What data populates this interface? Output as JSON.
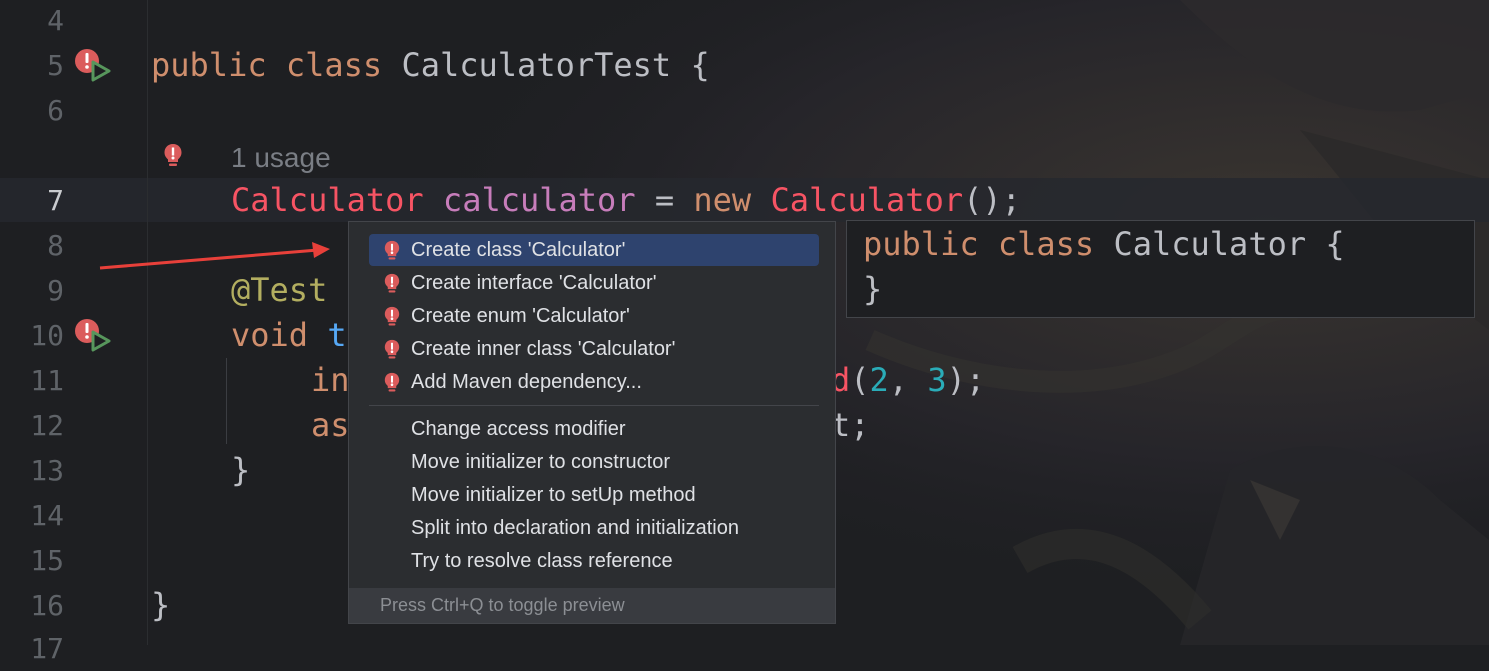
{
  "editor": {
    "line_numbers": [
      "4",
      "5",
      "6",
      "7",
      "8",
      "9",
      "10",
      "11",
      "12",
      "13",
      "14",
      "15",
      "16",
      "17"
    ],
    "current_line": "7",
    "inlay_hint": "1 usage",
    "lines": {
      "l5": {
        "kw1": "public",
        "kw2": "class",
        "name": "CalculatorTest",
        "brace": "{"
      },
      "l7": {
        "type": "Calculator",
        "field": "calculator",
        "eq": "=",
        "kw": "new",
        "ctor": "Calculator",
        "tail": "();"
      },
      "l9": {
        "annotation": "@Test"
      },
      "l10": {
        "kw": "void",
        "rest": "t"
      },
      "l11": {
        "start": "in",
        "call_end": "d",
        "paren": "(",
        "arg1": "2",
        "comma": ", ",
        "arg2": "3",
        "close": ");"
      },
      "l12": {
        "start": "as",
        "end": "t;"
      },
      "l13": {
        "brace": "}"
      },
      "l16": {
        "brace": "}"
      }
    }
  },
  "popup": {
    "items": [
      {
        "label": "Create class 'Calculator'",
        "icon": "bulb-error-icon",
        "selected": true
      },
      {
        "label": "Create interface 'Calculator'",
        "icon": "bulb-error-icon"
      },
      {
        "label": "Create enum 'Calculator'",
        "icon": "bulb-error-icon"
      },
      {
        "label": "Create inner class 'Calculator'",
        "icon": "bulb-error-icon"
      },
      {
        "label": "Add Maven dependency...",
        "icon": "bulb-error-icon"
      },
      {
        "label": "Change access modifier"
      },
      {
        "label": "Move initializer to constructor"
      },
      {
        "label": "Move initializer to setUp method"
      },
      {
        "label": "Split into declaration and initialization"
      },
      {
        "label": "Try to resolve class reference"
      }
    ],
    "footer": "Press Ctrl+Q to toggle preview"
  },
  "preview": {
    "line1": {
      "kw1": "public",
      "kw2": "class",
      "name": "Calculator",
      "brace": "{"
    },
    "line2": "}"
  },
  "colors": {
    "background": "#1e1f22",
    "keyword": "#cf8e6d",
    "error": "#f75464",
    "field": "#c77dbb",
    "annotation": "#b3ae60",
    "number": "#2aacb8",
    "selection": "#2e436e",
    "arrow": "#e8403a"
  }
}
